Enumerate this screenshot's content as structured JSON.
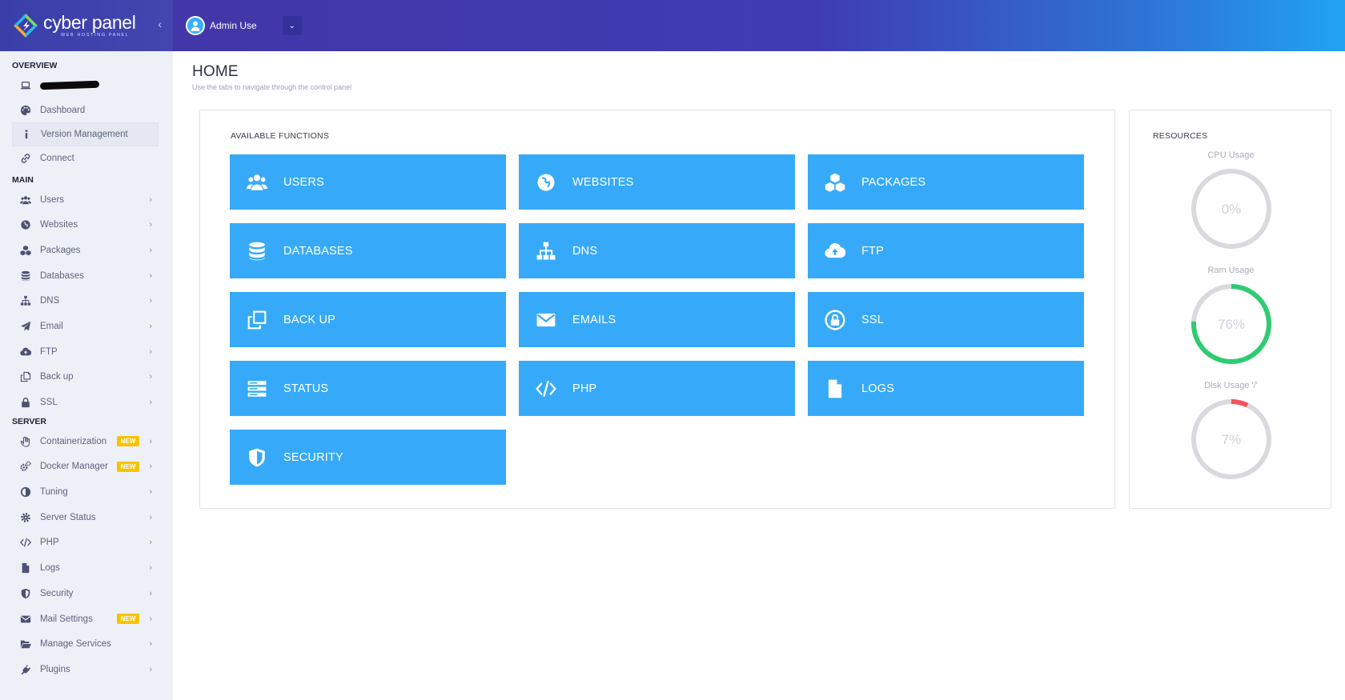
{
  "brand": {
    "name": "cyber panel",
    "tagline": "WEB HOSTING PANEL"
  },
  "header": {
    "user_name": "Admin Use"
  },
  "sidebar": {
    "sections": {
      "overview": "OVERVIEW",
      "main": "MAIN",
      "server": "SERVER"
    },
    "overview_items": [
      {
        "label": "Dashboard",
        "icon": "palette-icon"
      },
      {
        "label": "Version Management",
        "icon": "info-icon"
      },
      {
        "label": "Connect",
        "icon": "link-icon"
      }
    ],
    "main_items": [
      {
        "label": "Users",
        "icon": "users-icon"
      },
      {
        "label": "Websites",
        "icon": "globe-icon"
      },
      {
        "label": "Packages",
        "icon": "cubes-icon"
      },
      {
        "label": "Databases",
        "icon": "database-icon"
      },
      {
        "label": "DNS",
        "icon": "sitemap-icon"
      },
      {
        "label": "Email",
        "icon": "paper-plane-icon"
      },
      {
        "label": "FTP",
        "icon": "cloud-upload-icon"
      },
      {
        "label": "Back up",
        "icon": "copy-icon"
      },
      {
        "label": "SSL",
        "icon": "lock-icon"
      }
    ],
    "server_items": [
      {
        "label": "Containerization",
        "icon": "hand-icon",
        "badge": "NEW"
      },
      {
        "label": "Docker Manager",
        "icon": "cogs-icon",
        "badge": "NEW"
      },
      {
        "label": "Tuning",
        "icon": "adjust-icon"
      },
      {
        "label": "Server Status",
        "icon": "gear-icon"
      },
      {
        "label": "PHP",
        "icon": "code-icon"
      },
      {
        "label": "Logs",
        "icon": "file-icon"
      },
      {
        "label": "Security",
        "icon": "shield-icon"
      },
      {
        "label": "Mail Settings",
        "icon": "envelope-icon",
        "badge": "NEW"
      },
      {
        "label": "Manage Services",
        "icon": "folder-open-icon"
      },
      {
        "label": "Plugins",
        "icon": "plug-icon"
      }
    ]
  },
  "main": {
    "title": "HOME",
    "subtitle": "Use the tabs to navigate through the control panel",
    "functions_title": "AVAILABLE FUNCTIONS",
    "functions": [
      {
        "label": "USERS",
        "icon": "users-icon"
      },
      {
        "label": "WEBSITES",
        "icon": "globe-icon"
      },
      {
        "label": "PACKAGES",
        "icon": "cubes-icon"
      },
      {
        "label": "DATABASES",
        "icon": "database-icon"
      },
      {
        "label": "DNS",
        "icon": "sitemap-icon"
      },
      {
        "label": "FTP",
        "icon": "cloud-upload-icon"
      },
      {
        "label": "BACK UP",
        "icon": "copy-icon"
      },
      {
        "label": "EMAILS",
        "icon": "envelope-icon"
      },
      {
        "label": "SSL",
        "icon": "lock-icon"
      },
      {
        "label": "STATUS",
        "icon": "server-icon"
      },
      {
        "label": "PHP",
        "icon": "code-icon"
      },
      {
        "label": "LOGS",
        "icon": "file-icon"
      },
      {
        "label": "SECURITY",
        "icon": "shield-icon"
      }
    ]
  },
  "resources": {
    "title": "RESOURCES",
    "gauges": [
      {
        "label": "CPU Usage",
        "value": "0%",
        "percent": 0,
        "color": "#2ecc71"
      },
      {
        "label": "Ram Usage",
        "value": "76%",
        "percent": 76,
        "color": "#2ecc71"
      },
      {
        "label": "Disk Usage '/'",
        "value": "7%",
        "percent": 7,
        "color": "#f2545b"
      }
    ],
    "track_color": "#d9dadd"
  },
  "colors": {
    "tile": "#36aaf8",
    "header_start": "#4236a8",
    "header_end": "#21a3f1"
  }
}
